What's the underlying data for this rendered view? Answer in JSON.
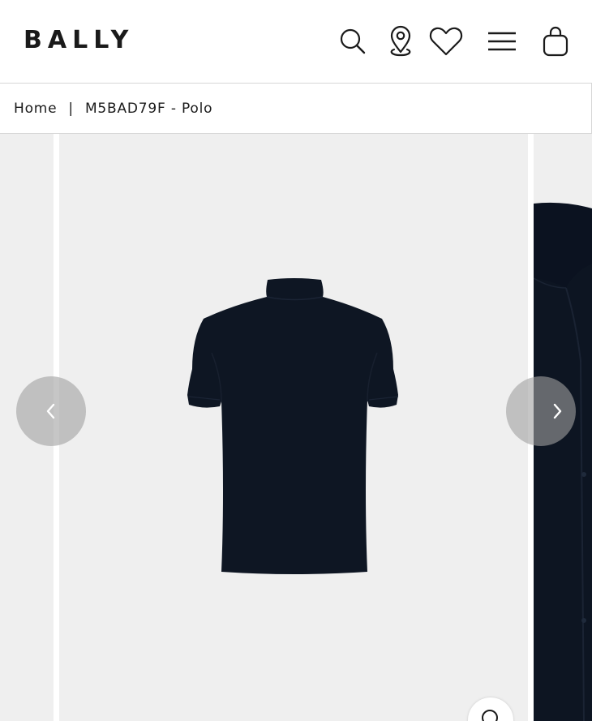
{
  "brand": {
    "logo_text": "BALLY"
  },
  "header": {
    "icons": [
      "search-icon",
      "store-locator-icon",
      "wishlist-icon",
      "menu-icon",
      "shopping-bag-icon"
    ]
  },
  "breadcrumb": {
    "home": "Home",
    "separator": "|",
    "current": "M5BAD79F - Polo"
  },
  "gallery": {
    "product_color": "#0e1623",
    "background": "#efefef"
  }
}
